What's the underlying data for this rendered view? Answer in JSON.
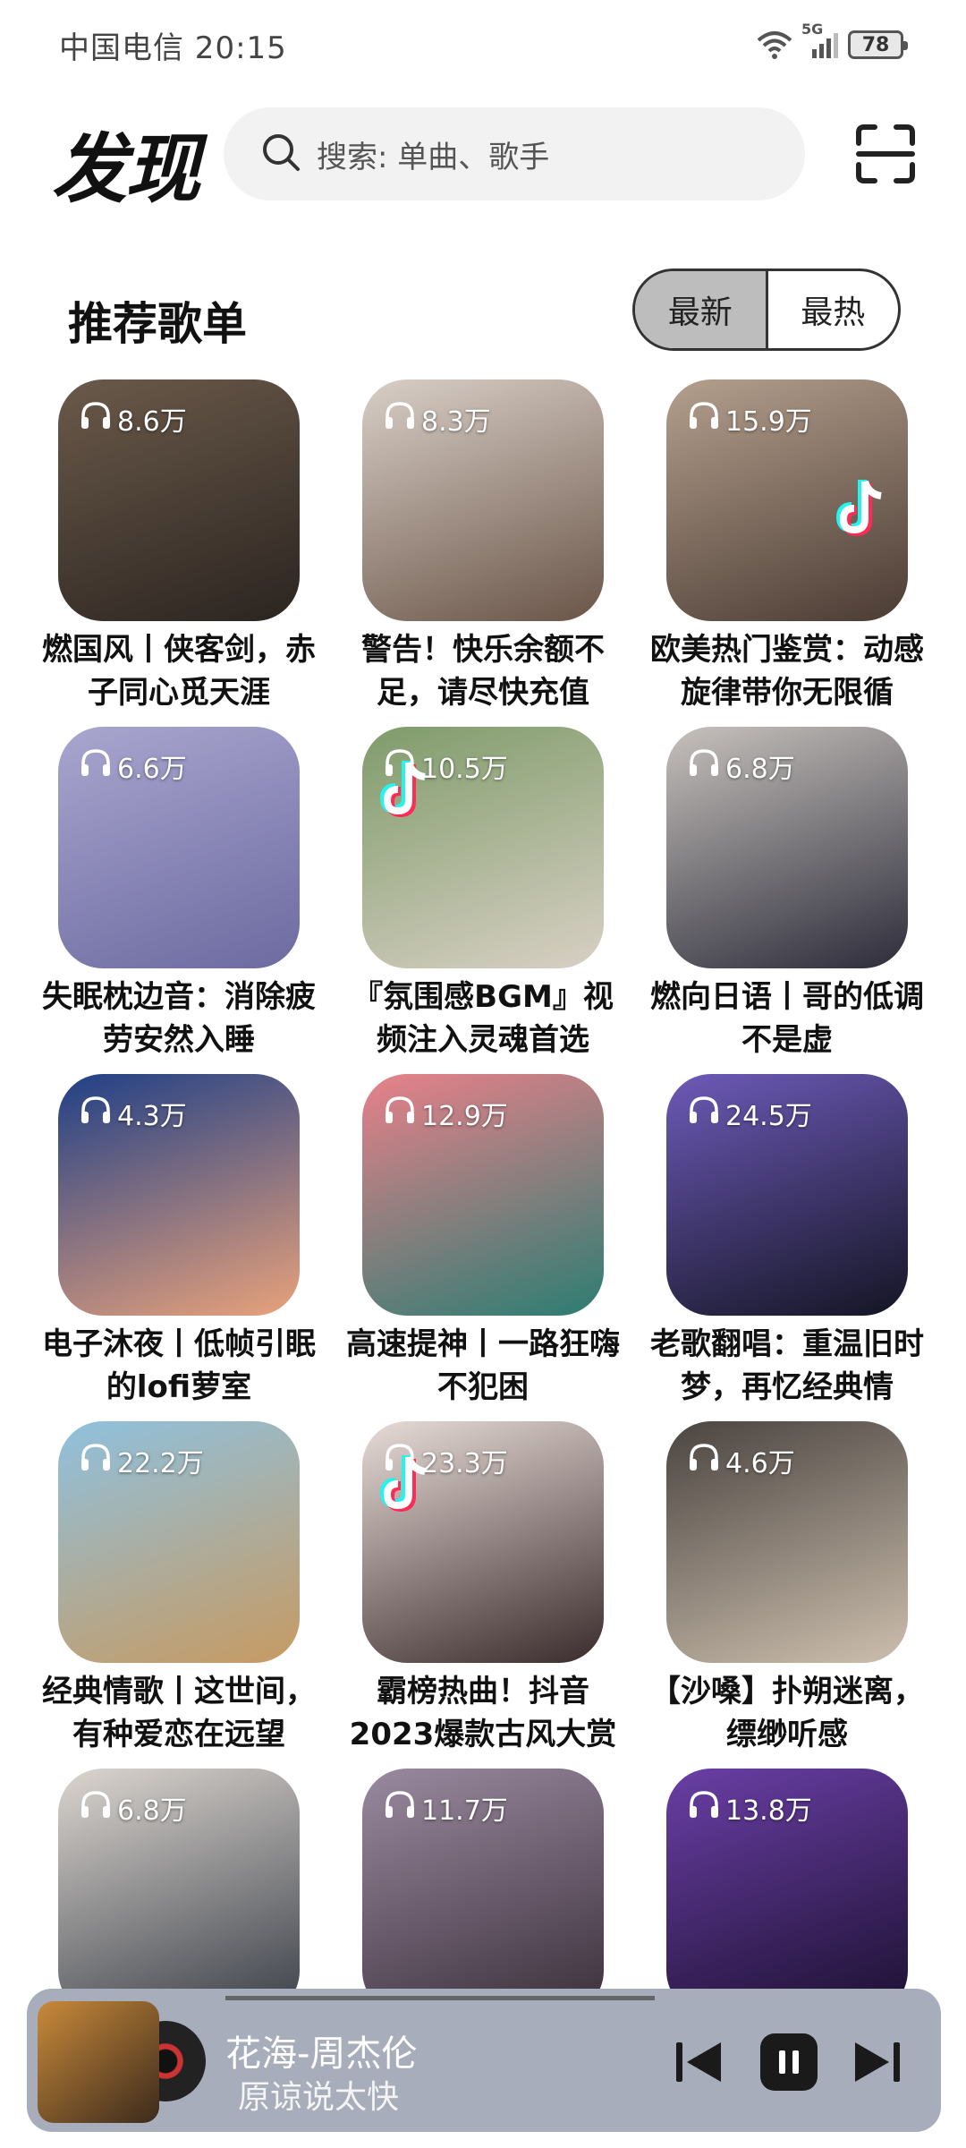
{
  "status": {
    "carrier_time": "中国电信 20:15",
    "network": "5G",
    "battery": "78"
  },
  "header": {
    "title": "发现",
    "search_placeholder": "搜索: 单曲、歌手",
    "scan_icon": "scan-icon"
  },
  "section": {
    "title": "推荐歌单",
    "tabs": [
      {
        "label": "最新",
        "active": true
      },
      {
        "label": "最热",
        "active": false
      }
    ]
  },
  "playlists": [
    {
      "count": "8.6万",
      "title": "燃国风丨侠客剑，赤子同心觅天涯",
      "colors": [
        "#6b5a4a",
        "#2b2420"
      ]
    },
    {
      "count": "8.3万",
      "title": "警告！快乐余额不足，请尽快充值",
      "colors": [
        "#d9cfc7",
        "#6a5548"
      ]
    },
    {
      "count": "15.9万",
      "title": "欧美热门鉴赏：动感旋律带你无限循",
      "colors": [
        "#b5a08e",
        "#4a3b33"
      ],
      "tiktok": true
    },
    {
      "count": "6.6万",
      "title": "失眠枕边音：消除疲劳安然入睡",
      "colors": [
        "#a9a6cf",
        "#6c6aa0"
      ]
    },
    {
      "count": "10.5万",
      "title": "『氛围感BGM』视频注入灵魂首选",
      "colors": [
        "#7f9b6a",
        "#d8d0c4"
      ],
      "tiktok": true
    },
    {
      "count": "6.8万",
      "title": "燃向日语丨哥的低调不是虚",
      "colors": [
        "#c7c2bd",
        "#2d2c3a"
      ]
    },
    {
      "count": "4.3万",
      "title": "电子沐夜丨低帧引眠的lofi萝室",
      "colors": [
        "#1f3f86",
        "#e9a27b"
      ]
    },
    {
      "count": "12.9万",
      "title": "高速提神丨一路狂嗨不犯困",
      "colors": [
        "#e9818a",
        "#2c7d72"
      ]
    },
    {
      "count": "24.5万",
      "title": "老歌翻唱：重温旧时梦，再忆经典情",
      "colors": [
        "#6d5ab8",
        "#141524"
      ]
    },
    {
      "count": "22.2万",
      "title": "经典情歌丨这世间，有种爱恋在远望",
      "colors": [
        "#8fc1de",
        "#c79a62"
      ]
    },
    {
      "count": "23.3万",
      "title": "霸榜热曲！抖音2023爆款古风大赏",
      "colors": [
        "#e8dcd8",
        "#3a2c2c"
      ],
      "tiktok": true
    },
    {
      "count": "4.6万",
      "title": "【沙嗓】扑朔迷离，缥缈听感",
      "colors": [
        "#4a4440",
        "#cdbfae"
      ]
    },
    {
      "count": "6.8万",
      "title": "",
      "colors": [
        "#dcd6d0",
        "#3a3f48"
      ]
    },
    {
      "count": "11.7万",
      "title": "",
      "colors": [
        "#9a8aa0",
        "#3b2f3a"
      ]
    },
    {
      "count": "13.8万",
      "title": "",
      "colors": [
        "#6a3fa6",
        "#1c1030"
      ]
    }
  ],
  "player": {
    "track": "花海-周杰伦",
    "lyric": "原谅说太快",
    "progress": 0.0,
    "colors": [
      "#c98a3a",
      "#3b2a1c"
    ]
  }
}
